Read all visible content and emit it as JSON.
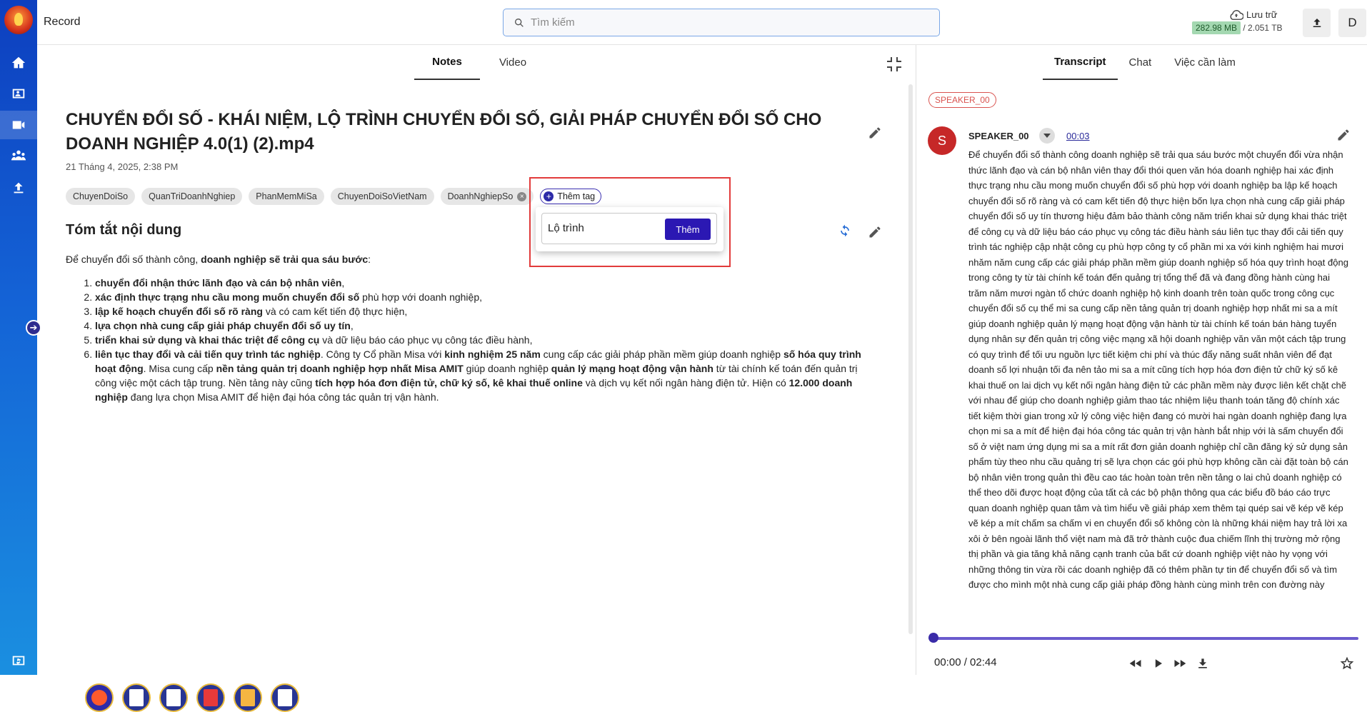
{
  "header": {
    "app_title": "Record",
    "search_placeholder": "Tìm kiếm",
    "storage_label": "Lưu trữ",
    "storage_used": "282.98 MB",
    "storage_total": "/ 2.051 TB",
    "user_initial": "D"
  },
  "notes": {
    "tabs": [
      "Notes",
      "Video"
    ],
    "active_tab": "Notes",
    "title": "CHUYỂN ĐỔI SỐ - KHÁI NIỆM, LỘ TRÌNH CHUYỂN ĐỔI SỐ, GIẢI PHÁP CHUYỂN ĐỔI SỐ CHO DOANH NGHIỆP 4.0(1) (2).mp4",
    "date": "21 Tháng 4, 2025, 2:38 PM",
    "tags": [
      "ChuyenDoiSo",
      "QuanTriDoanhNghiep",
      "PhanMemMiSa",
      "ChuyenDoiSoVietNam",
      "DoanhNghiepSo"
    ],
    "add_tag_label": "Thêm tag",
    "tag_input_value": "Lộ trình",
    "tag_add_button": "Thêm",
    "summary_heading": "Tóm tắt nội dung",
    "summary_intro_plain": "Để chuyển đổi số thành công, ",
    "summary_intro_bold": "doanh nghiệp sẽ trải qua sáu bước",
    "summary_intro_end": ":"
  },
  "transcript": {
    "tabs": [
      "Transcript",
      "Chat",
      "Việc cần làm"
    ],
    "active_tab": "Transcript",
    "speaker_filter": "SPEAKER_00",
    "speaker_initial": "S",
    "speaker_name": "SPEAKER_00",
    "speaker_time": "00:03",
    "text": "Để chuyển đổi số thành công doanh nghiệp sẽ trải qua sáu bước một chuyển đổi vừa nhận thức lãnh đạo và cán bộ nhân viên thay đổi thói quen văn hóa doanh nghiệp hai xác định thực trạng nhu cầu mong muốn chuyển đổi số phù hợp với doanh nghiệp ba lập kế hoạch chuyển đổi số rõ ràng và có cam kết tiến độ thực hiện bốn lựa chọn nhà cung cấp giải pháp chuyển đổi số uy tín thương hiệu đảm bảo thành công năm triển khai sử dụng khai thác triệt để công cụ và dữ liệu báo cáo phục vụ công tác điều hành sáu liên tục thay đổi cải tiến quy trình tác nghiệp cập nhật công cụ phù hợp công ty cổ phần mi xa với kinh nghiệm hai mươi nhăm năm cung cấp các giải pháp phần mềm giúp doanh nghiệp số hóa quy trình hoạt động trong công ty từ tài chính kế toán đến quảng trị tổng thể đã và đang đồng hành cùng hai trăm năm mươi ngàn tổ chức doanh nghiệp hộ kinh doanh trên toàn quốc trong công cục chuyển đổi số cụ thể mi sa cung cấp nền tảng quản trị doanh nghiệp hợp nhất mi sa a mít giúp doanh nghiệp quản lý mạng hoạt động vận hành từ tài chính kế toán bán hàng tuyển dụng nhân sự đến quản trị công việc mạng xã hội doanh nghiệp văn văn một cách tập trung có quy trình để tối ưu nguồn lực tiết kiệm chi phí và thúc đẩy năng suất nhân viên để đạt doanh số lợi nhuận tối đa nên tảo mi sa a mít cũng tích hợp hóa đơn điện tử chữ ký số kê khai thuế on lai dịch vụ kết nối ngân hàng điện tử các phần mềm này được liên kết chặt chẽ với nhau để giúp cho doanh nghiệp giảm thao tác nhiệm liệu thanh toán tăng độ chính xác tiết kiệm thời gian trong xử lý công việc hiện đang có mười hai ngàn doanh nghiệp đang lựa chọn mi sa a mít để hiện đại hóa công tác quản trị vận hành bắt nhịp với là sấm chuyển đổi số ở việt nam ứng dụng mi sa a mít rất đơn giản doanh nghiệp chỉ cần đăng ký sử dụng sản phẩm tùy theo nhu cầu quảng trị sẽ lựa chọn các gói phù hợp không cần cài đặt toàn bộ cán bộ nhân viên trong quản thì đều cao tác hoàn toàn trên nền tảng o lai chủ doanh nghiệp có thể theo dõi được hoạt động của tất cả các bộ phận thông qua các biểu đồ báo cáo trực quan doanh nghiệp quan tâm và tìm hiểu về giải pháp xem thêm tại quép sai vẽ kép vẽ kép vẽ kép a mít chấm sa chấm vi en chuyển đổi số không còn là những khái niệm hay trả lời xa xôi ở bên ngoài lãnh thổ việt nam mà đã trở thành cuộc đua chiếm lĩnh thị trường mở rộng thị phần và gia tăng khả năng cạnh tranh của bất cứ doanh nghiệp việt nào hy vọng với những thông tin vừa rồi các doanh nghiệp đã có thêm phần tự tin để chuyển đổi số và tìm được cho mình một nhà cung cấp giải pháp đồng hành cùng mình trên con đường này",
    "player_time": "00:00 / 02:44",
    "progress": 0
  }
}
